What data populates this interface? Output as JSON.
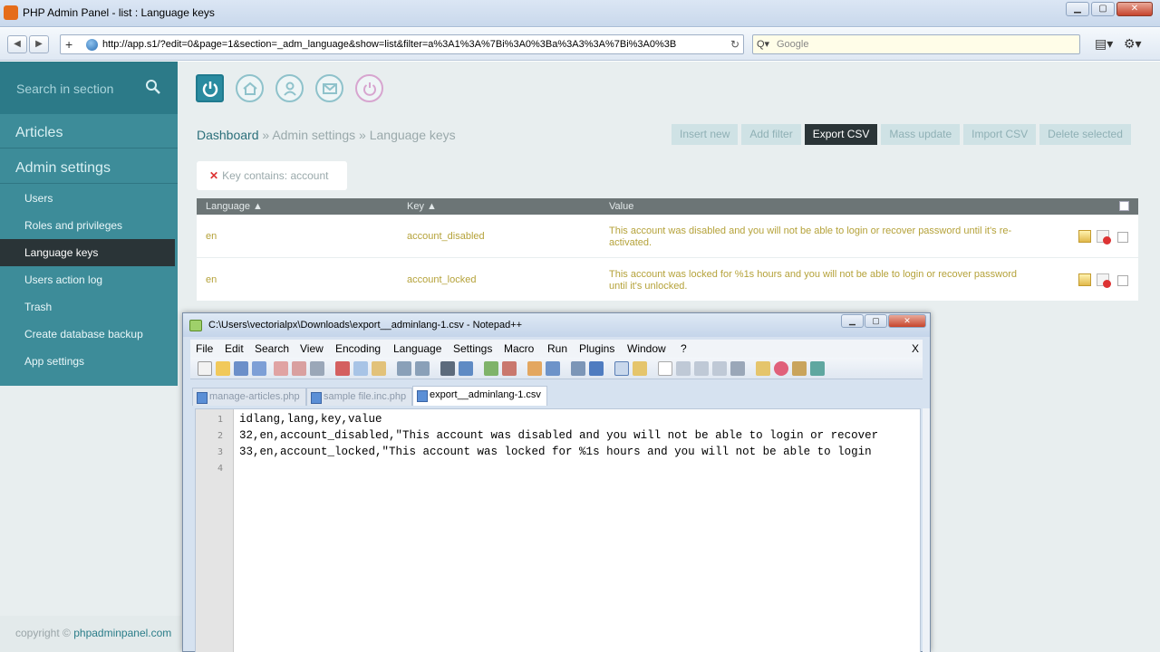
{
  "browser": {
    "window_title": "PHP Admin Panel - list : Language keys",
    "url": "http://app.s1/?edit=0&page=1&section=_adm_language&show=list&filter=a%3A1%3A%7Bi%3A0%3Ba%3A3%3A%7Bi%3A0%3B",
    "search_placeholder": "Google"
  },
  "sidebar": {
    "search_placeholder": "Search in section",
    "sections": [
      "Articles",
      "Admin settings"
    ],
    "items": [
      {
        "label": "Users"
      },
      {
        "label": "Roles and privileges"
      },
      {
        "label": "Language keys",
        "active": true
      },
      {
        "label": "Users action log"
      },
      {
        "label": "Trash"
      },
      {
        "label": "Create database backup"
      },
      {
        "label": "App settings"
      }
    ]
  },
  "breadcrumb": {
    "items": [
      "Dashboard",
      "Admin settings",
      "Language keys"
    ],
    "separator": "»"
  },
  "actions": [
    "Insert new",
    "Add filter",
    "Export CSV",
    "Mass update",
    "Import CSV",
    "Delete selected"
  ],
  "filter": {
    "label": "Key contains: account"
  },
  "table": {
    "headers": [
      "Language ▲",
      "Key ▲",
      "Value"
    ],
    "rows": [
      {
        "language": "en",
        "key": "account_disabled",
        "value": "This account was disabled and you will not be able to login or recover password until it's re-activated."
      },
      {
        "language": "en",
        "key": "account_locked",
        "value": "This account was locked for %1s hours and you will not be able to login or recover password until it's unlocked."
      }
    ]
  },
  "footer": {
    "copyright": "copyright ©",
    "link": "phpadminpanel.com"
  },
  "notepad": {
    "title": "C:\\Users\\vectorialpx\\Downloads\\export__adminlang-1.csv - Notepad++",
    "menu": [
      "File",
      "Edit",
      "Search",
      "View",
      "Encoding",
      "Language",
      "Settings",
      "Macro",
      "Run",
      "Plugins",
      "Window",
      "?"
    ],
    "menu_close": "X",
    "tabs": [
      "manage-articles.php",
      "sample file.inc.php",
      "export__adminlang-1.csv"
    ],
    "line_numbers": [
      "1",
      "2",
      "3",
      "4"
    ],
    "lines": [
      "idlang,lang,key,value",
      "32,en,account_disabled,\"This account was disabled and you will not be able to login or recover",
      "33,en,account_locked,\"This account was locked for %1s hours and you will not be able to login",
      ""
    ]
  },
  "colors": {
    "sidebar": "#3d8c99",
    "accent_dark": "#2a3437",
    "value_text": "#b5a23a"
  }
}
